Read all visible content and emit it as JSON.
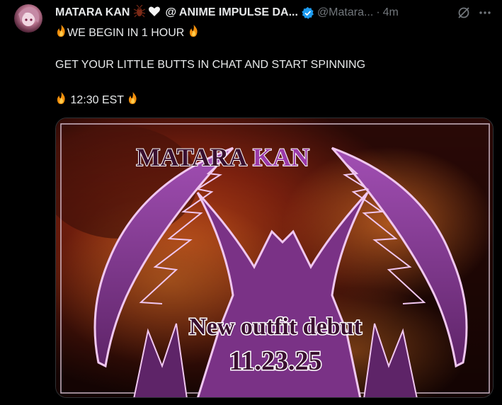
{
  "author": {
    "display_name": "MATARA KAN",
    "name_suffix": "@ ANIME IMPULSE DA...",
    "handle": "@Matara...",
    "time_separator": "·",
    "time_ago": "4m"
  },
  "tweet": {
    "line1": "WE BEGIN IN 1 HOUR",
    "line2": "GET YOUR LITTLE BUTTS IN CHAT AND START SPINNING",
    "line3": "12:30 EST"
  },
  "media": {
    "title_left": "MATARA",
    "title_right": "KAN",
    "subtitle": "New outfit debut",
    "date": "11.23.25"
  },
  "icons": {
    "bug": "cockroach-icon",
    "heart": "white-heart-icon",
    "verified": "verified-badge-icon",
    "grok": "grok-icon",
    "more": "more-options-icon",
    "fire": "fire-emoji-icon"
  },
  "colors": {
    "verified": "#1d9bf0",
    "muted": "#71767b",
    "text": "#e7e9ea",
    "banner_purple": "#8a3e9a"
  }
}
